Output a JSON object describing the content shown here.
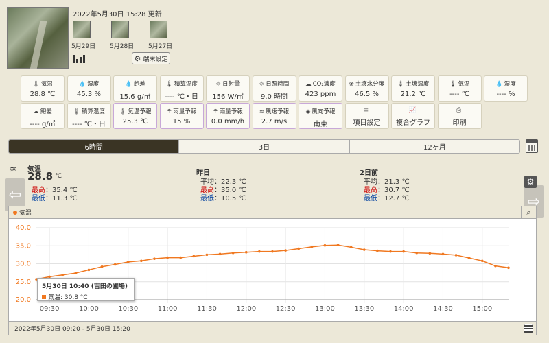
{
  "header": {
    "update_time": "2022年5月30日 15:28 更新",
    "thumbnails": [
      {
        "date": "5月29日"
      },
      {
        "date": "5月28日"
      },
      {
        "date": "5月27日"
      }
    ],
    "terminal_button": "端末設定"
  },
  "tiles": [
    {
      "name": "air-temp",
      "icon": "thermometer-icon",
      "label": "気温",
      "value": "28.8 ℃"
    },
    {
      "name": "humidity",
      "icon": "droplet-icon",
      "label": "湿度",
      "value": "45.3 %"
    },
    {
      "name": "saturation-deficit",
      "icon": "droplet-icon",
      "label": "飽差",
      "value": "15.6 g/㎥"
    },
    {
      "name": "accumulated-temp",
      "icon": "thermometer-icon",
      "label": "積算温度",
      "value": "---- ℃・日"
    },
    {
      "name": "solar-radiation",
      "icon": "sun-icon",
      "label": "日射量",
      "value": "156 W/㎡"
    },
    {
      "name": "sunshine-hours",
      "icon": "sun-icon",
      "label": "日照時間",
      "value": "9.0 時間"
    },
    {
      "name": "co2",
      "icon": "cloud-icon",
      "label": "CO₂濃度",
      "value": "423 ppm"
    },
    {
      "name": "soil-moisture",
      "icon": "soil-icon",
      "label": "土壌水分度",
      "value": "46.5 %"
    },
    {
      "name": "soil-temp",
      "icon": "thermometer-icon",
      "label": "土壌温度",
      "value": "21.2 ℃"
    },
    {
      "name": "air-temp-2",
      "icon": "thermometer-icon",
      "label": "気温",
      "value": "---- ℃"
    },
    {
      "name": "humidity-2",
      "icon": "droplet-icon",
      "label": "湿度",
      "value": "---- %"
    },
    {
      "name": "saturation-deficit-2",
      "icon": "cloud-icon",
      "label": "飽差",
      "value": "---- g/㎥"
    },
    {
      "name": "accumulated-temp-2",
      "icon": "thermometer-icon",
      "label": "積算温度",
      "value": "---- ℃・日"
    },
    {
      "name": "temp-forecast",
      "icon": "thermometer-icon",
      "label": "気温予報",
      "value": "25.3 ℃",
      "forecast": true
    },
    {
      "name": "rain-forecast",
      "icon": "rain-icon",
      "label": "雨量予報",
      "value": "15 %",
      "forecast": true
    },
    {
      "name": "precip-forecast",
      "icon": "rain-icon",
      "label": "雨量予報",
      "value": "0.0 mm/h",
      "forecast": true
    },
    {
      "name": "wind-speed-forecast",
      "icon": "wind-icon",
      "label": "風速予報",
      "value": "2.7 m/s",
      "forecast": true
    },
    {
      "name": "wind-dir-forecast",
      "icon": "compass-icon",
      "label": "風向予報",
      "value": "南東",
      "forecast": true
    },
    {
      "name": "item-settings",
      "icon": "list-icon",
      "label": "",
      "value": "項目設定"
    },
    {
      "name": "composite-graph",
      "icon": "graph-icon",
      "label": "",
      "value": "複合グラフ"
    },
    {
      "name": "print",
      "icon": "printer-icon",
      "label": "",
      "value": "印刷"
    }
  ],
  "tabs": [
    "6時間",
    "3日",
    "12ヶ月"
  ],
  "stats": {
    "label": "気温",
    "current": "28.8",
    "unit": "℃",
    "max_label": "最高",
    "min_label": "最低",
    "avg_label": "平均",
    "today_max": "：35.4 ℃",
    "today_min": "：11.3 ℃",
    "yesterday_title": "昨日",
    "yesterday_avg": "：22.3 ℃",
    "yesterday_max": "：35.0 ℃",
    "yesterday_min": "：10.5 ℃",
    "two_days_title": "2日前",
    "two_days_avg": "：21.3 ℃",
    "two_days_max": "：30.7 ℃",
    "two_days_min": "：12.7 ℃"
  },
  "chart_panel": {
    "series_label": "気温",
    "range": "2022年5月30日 09:20 - 5月30日 15:20",
    "tooltip_title": "5月30日 10:40 (吉田の圃場)",
    "tooltip_value": "気温: 30.8 °C"
  },
  "chart_data": {
    "type": "line",
    "series": [
      {
        "name": "気温",
        "color": "#f07820",
        "x": [
          "09:20",
          "09:30",
          "09:40",
          "09:50",
          "10:00",
          "10:10",
          "10:20",
          "10:30",
          "10:40",
          "10:50",
          "11:00",
          "11:10",
          "11:20",
          "11:30",
          "11:40",
          "11:50",
          "12:00",
          "12:10",
          "12:20",
          "12:30",
          "12:40",
          "12:50",
          "13:00",
          "13:10",
          "13:20",
          "13:30",
          "13:40",
          "13:50",
          "14:00",
          "14:10",
          "14:20",
          "14:30",
          "14:40",
          "14:50",
          "15:00",
          "15:10",
          "15:20"
        ],
        "values": [
          25.7,
          26.4,
          26.9,
          27.4,
          28.3,
          29.2,
          29.8,
          30.5,
          30.8,
          31.4,
          31.7,
          31.7,
          32.1,
          32.5,
          32.7,
          33.0,
          33.2,
          33.4,
          33.4,
          33.7,
          34.2,
          34.7,
          35.1,
          35.2,
          34.6,
          33.9,
          33.6,
          33.4,
          33.4,
          33.0,
          32.9,
          32.7,
          32.4,
          31.6,
          30.8,
          29.4,
          28.9
        ]
      }
    ],
    "ylim": [
      20,
      40
    ],
    "yticks": [
      "20.0",
      "25.0",
      "30.0",
      "35.0",
      "40.0"
    ],
    "xticks": [
      "09:30",
      "10:00",
      "10:30",
      "11:00",
      "11:30",
      "12:00",
      "12:30",
      "13:00",
      "13:30",
      "14:00",
      "14:30",
      "15:00"
    ],
    "grid": true
  }
}
